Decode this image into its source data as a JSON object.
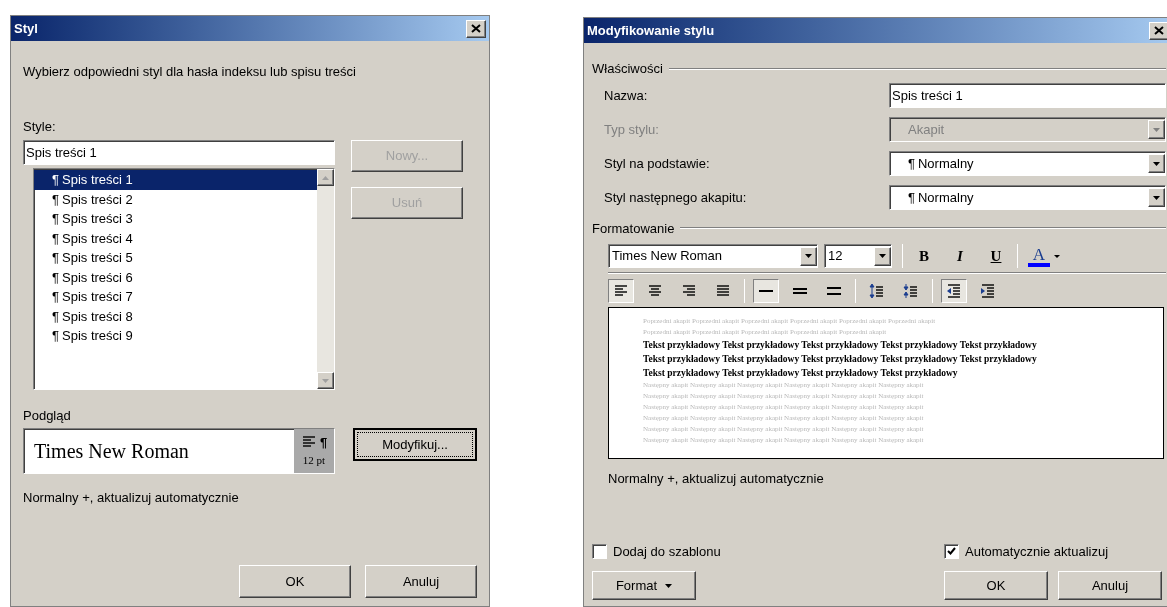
{
  "style_dialog": {
    "title": "Styl",
    "prompt": "Wybierz odpowiedni styl dla hasła indeksu lub spisu treści",
    "styles_label": "Style:",
    "styles_value": "Spis treści 1",
    "side_buttons": [
      {
        "label": "Nowy...",
        "disabled": true
      },
      {
        "label": "Usuń",
        "disabled": true
      }
    ],
    "style_list": [
      {
        "mark": "¶",
        "label": "Spis treści 1",
        "selected": true
      },
      {
        "mark": "¶",
        "label": "Spis treści 2",
        "selected": false
      },
      {
        "mark": "¶",
        "label": "Spis treści 3",
        "selected": false
      },
      {
        "mark": "¶",
        "label": "Spis treści 4",
        "selected": false
      },
      {
        "mark": "¶",
        "label": "Spis treści 5",
        "selected": false
      },
      {
        "mark": "¶",
        "label": "Spis treści 6",
        "selected": false
      },
      {
        "mark": "¶",
        "label": "Spis treści 7",
        "selected": false
      },
      {
        "mark": "¶",
        "label": "Spis treści 8",
        "selected": false
      },
      {
        "mark": "¶",
        "label": "Spis treści 9",
        "selected": false
      }
    ],
    "preview_label": "Podgląd",
    "preview": {
      "font_sample": "Times New Roman",
      "paragraph_mark": "¶",
      "size": "12 pt"
    },
    "modify_button": {
      "label": "Modyfikuj...",
      "focused": true
    },
    "description": "Normalny +, aktualizuj automatycznie",
    "buttons": [
      "OK",
      "Anuluj"
    ]
  },
  "modify_dialog": {
    "title": "Modyfikowanie stylu",
    "properties_label": "Właściwości",
    "fields": [
      {
        "kind": "input",
        "label": "Nazwa:",
        "value": "Spis treści 1",
        "disabled": false
      },
      {
        "kind": "select",
        "label": "Typ stylu:",
        "value": "Akapit",
        "disabled": true
      },
      {
        "kind": "select",
        "label": "Styl na podstawie:",
        "mark": "¶",
        "value": "Normalny",
        "disabled": false
      },
      {
        "kind": "select",
        "label": "Styl następnego akapitu:",
        "mark": "¶",
        "value": "Normalny",
        "disabled": false
      }
    ],
    "formatting_label": "Formatowanie",
    "font": "Times New Roman",
    "size": "12",
    "text_styles": [
      {
        "kind": "bold",
        "label": "B"
      },
      {
        "kind": "italic",
        "label": "I"
      },
      {
        "kind": "underline",
        "label": "U"
      }
    ],
    "font_color": {
      "label": "A"
    },
    "paragraph_tools": [
      {
        "kind": "align-left",
        "selected": true
      },
      {
        "kind": "align-center",
        "selected": false
      },
      {
        "kind": "align-right",
        "selected": false
      },
      {
        "kind": "justify",
        "selected": false
      },
      {
        "kind": "separator"
      },
      {
        "kind": "spacing-single",
        "selected": true
      },
      {
        "kind": "spacing-one-half",
        "selected": false
      },
      {
        "kind": "spacing-double",
        "selected": false
      },
      {
        "kind": "separator"
      },
      {
        "kind": "space-increase",
        "selected": false
      },
      {
        "kind": "space-decrease",
        "selected": false
      },
      {
        "kind": "separator"
      },
      {
        "kind": "indent-decrease",
        "selected": true
      },
      {
        "kind": "indent-increase",
        "selected": false
      }
    ],
    "preview": {
      "previous": [
        "Poprzedni akapit Poprzedni akapit Poprzedni akapit Poprzedni akapit Poprzedni akapit Poprzedni akapit",
        "Poprzedni akapit Poprzedni akapit Poprzedni akapit Poprzedni akapit Poprzedni akapit"
      ],
      "sample": [
        "Tekst przykładowy Tekst przykładowy Tekst przykładowy Tekst przykładowy Tekst przykładowy",
        "Tekst przykładowy Tekst przykładowy Tekst przykładowy Tekst przykładowy Tekst przykładowy",
        "Tekst przykładowy Tekst przykładowy Tekst przykładowy Tekst przykładowy"
      ],
      "following": [
        "Następny akapit Następny akapit Następny akapit Następny akapit Następny akapit Następny akapit",
        "Następny akapit Następny akapit Następny akapit Następny akapit Następny akapit Następny akapit",
        "Następny akapit Następny akapit Następny akapit Następny akapit Następny akapit Następny akapit",
        "Następny akapit Następny akapit Następny akapit Następny akapit Następny akapit Następny akapit",
        "Następny akapit Następny akapit Następny akapit Następny akapit Następny akapit Następny akapit",
        "Następny akapit Następny akapit Następny akapit Następny akapit Następny akapit Następny akapit"
      ]
    },
    "description": "Normalny +, aktualizuj automatycznie",
    "checkboxes": [
      {
        "label": "Dodaj do szablonu",
        "checked": false
      },
      {
        "label": "Automatycznie aktualizuj",
        "checked": true
      }
    ],
    "format_button": "Format",
    "buttons": [
      "OK",
      "Anuluj"
    ]
  }
}
